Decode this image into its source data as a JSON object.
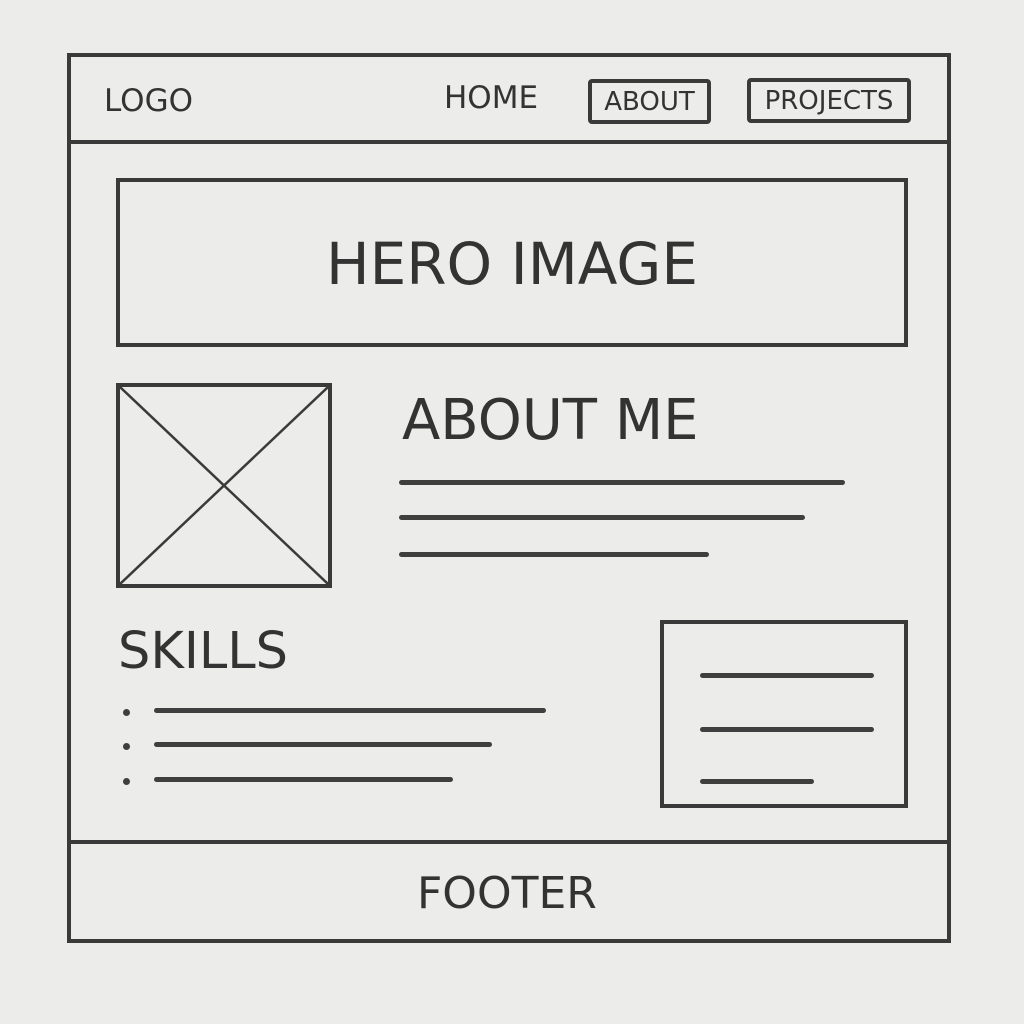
{
  "header": {
    "logo": "LOGO",
    "nav": [
      {
        "label": "HOME"
      },
      {
        "label": "ABOUT"
      },
      {
        "label": "PROJECTS"
      }
    ]
  },
  "hero": {
    "label": "HERO IMAGE"
  },
  "about": {
    "heading": "ABOUT ME",
    "placeholder_lines": 3
  },
  "skills": {
    "heading": "SKILLS",
    "bullet_items": 3
  },
  "sidebar_card": {
    "placeholder_lines": 3
  },
  "footer": {
    "label": "FOOTER"
  },
  "colors": {
    "ink": "#3a3a3a",
    "paper": "#ececea"
  }
}
